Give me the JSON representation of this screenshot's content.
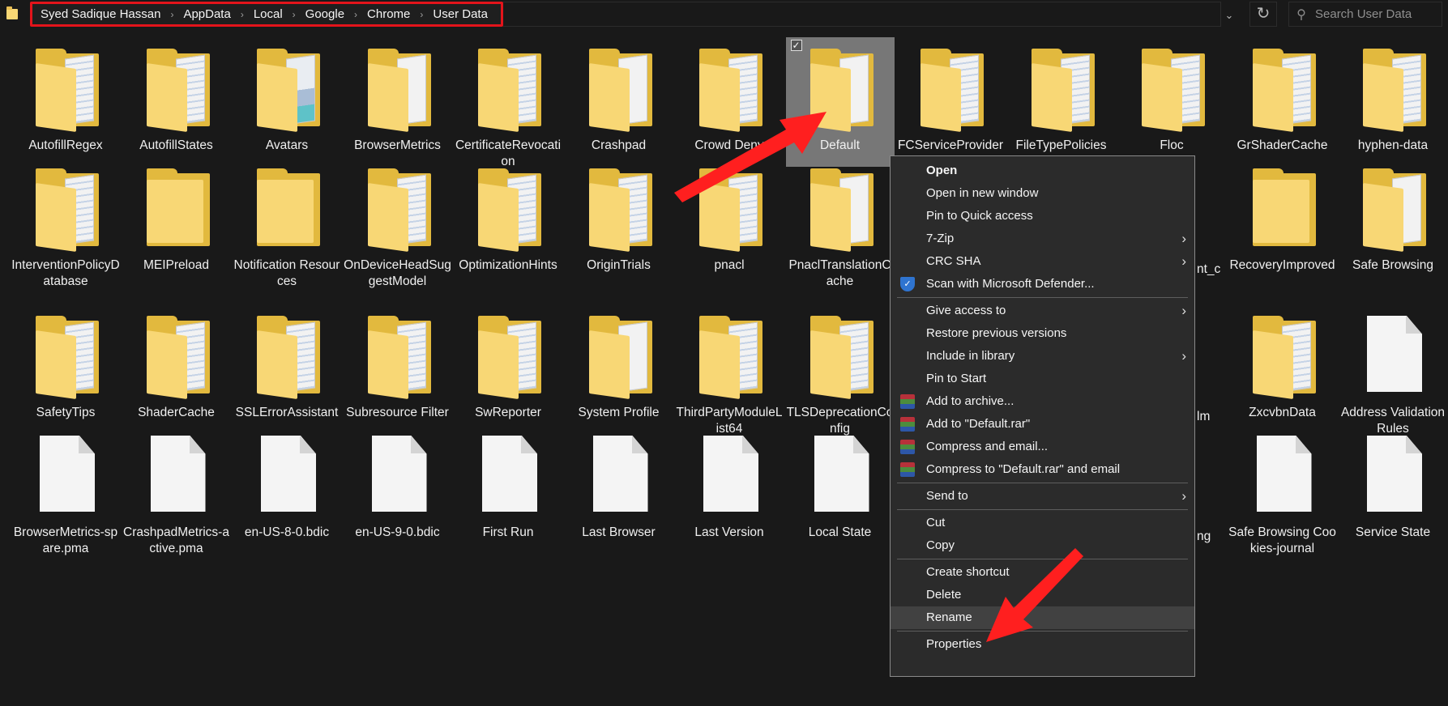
{
  "breadcrumb": [
    "Syed Sadique Hassan",
    "AppData",
    "Local",
    "Google",
    "Chrome",
    "User Data"
  ],
  "search": {
    "placeholder": "Search User Data"
  },
  "icons": {
    "dropdown": "chevron-down-icon",
    "refresh": "refresh-icon",
    "search": "search-icon"
  },
  "rows": [
    [
      {
        "label": "AutofillRegex",
        "kind": "folder",
        "style": "stripe"
      },
      {
        "label": "AutofillStates",
        "kind": "folder",
        "style": "stripe"
      },
      {
        "label": "Avatars",
        "kind": "folder",
        "style": "pic"
      },
      {
        "label": "BrowserMetrics",
        "kind": "folder",
        "style": "plain-paper"
      },
      {
        "label": "CertificateRevocation",
        "kind": "folder",
        "style": "stripe"
      },
      {
        "label": "Crashpad",
        "kind": "folder",
        "style": "plain-paper"
      },
      {
        "label": "Crowd Deny",
        "kind": "folder",
        "style": "stripe"
      },
      {
        "label": "Default",
        "kind": "folder",
        "style": "plain-paper",
        "selected": true
      },
      {
        "label": "FCServiceProvider",
        "kind": "folder",
        "style": "stripe"
      },
      {
        "label": "FileTypePolicies",
        "kind": "folder",
        "style": "stripe"
      },
      {
        "label": "Floc",
        "kind": "folder",
        "style": "stripe"
      },
      {
        "label": "GrShaderCache",
        "kind": "folder",
        "style": "stripe"
      },
      {
        "label": "hyphen-data",
        "kind": "folder",
        "style": "stripe"
      }
    ],
    [
      {
        "label": "InterventionPolicyDatabase",
        "kind": "folder",
        "style": "stripe"
      },
      {
        "label": "MEIPreload",
        "kind": "folder",
        "style": "plain"
      },
      {
        "label": "Notification Resources",
        "kind": "folder",
        "style": "plain"
      },
      {
        "label": "OnDeviceHeadSuggestModel",
        "kind": "folder",
        "style": "stripe"
      },
      {
        "label": "OptimizationHints",
        "kind": "folder",
        "style": "stripe"
      },
      {
        "label": "OriginTrials",
        "kind": "folder",
        "style": "stripe"
      },
      {
        "label": "pnacl",
        "kind": "folder",
        "style": "stripe"
      },
      {
        "label": "PnaclTranslationCache",
        "kind": "folder",
        "style": "plain-paper"
      },
      null,
      null,
      {
        "label": "nt_c",
        "kind": "folder",
        "style": "partial"
      },
      {
        "label": "RecoveryImproved",
        "kind": "folder",
        "style": "plain"
      },
      {
        "label": "Safe Browsing",
        "kind": "folder",
        "style": "plain-paper"
      }
    ],
    [
      {
        "label": "SafetyTips",
        "kind": "folder",
        "style": "stripe"
      },
      {
        "label": "ShaderCache",
        "kind": "folder",
        "style": "stripe"
      },
      {
        "label": "SSLErrorAssistant",
        "kind": "folder",
        "style": "stripe"
      },
      {
        "label": "Subresource Filter",
        "kind": "folder",
        "style": "stripe"
      },
      {
        "label": "SwReporter",
        "kind": "folder",
        "style": "stripe"
      },
      {
        "label": "System Profile",
        "kind": "folder",
        "style": "plain-paper"
      },
      {
        "label": "ThirdPartyModuleList64",
        "kind": "folder",
        "style": "stripe"
      },
      {
        "label": "TLSDeprecationConfig",
        "kind": "folder",
        "style": "stripe"
      },
      null,
      null,
      {
        "label": "lm",
        "kind": "folder",
        "style": "partial"
      },
      {
        "label": "ZxcvbnData",
        "kind": "folder",
        "style": "stripe"
      },
      {
        "label": "Address Validation Rules",
        "kind": "file"
      }
    ],
    [
      {
        "label": "BrowserMetrics-spare.pma",
        "kind": "file"
      },
      {
        "label": "CrashpadMetrics-active.pma",
        "kind": "file"
      },
      {
        "label": "en-US-8-0.bdic",
        "kind": "file"
      },
      {
        "label": "en-US-9-0.bdic",
        "kind": "file"
      },
      {
        "label": "First Run",
        "kind": "file"
      },
      {
        "label": "Last Browser",
        "kind": "file"
      },
      {
        "label": "Last Version",
        "kind": "file"
      },
      {
        "label": "Local State",
        "kind": "file"
      },
      null,
      null,
      {
        "label": "ng",
        "kind": "file",
        "style": "partial"
      },
      {
        "label": "Safe Browsing Cookies-journal",
        "kind": "file"
      },
      {
        "label": "Service State",
        "kind": "file"
      }
    ]
  ],
  "context_menu": {
    "items": [
      {
        "label": "Open",
        "bold": true
      },
      {
        "label": "Open in new window"
      },
      {
        "label": "Pin to Quick access"
      },
      {
        "label": "7-Zip",
        "submenu": true
      },
      {
        "label": "CRC SHA",
        "submenu": true
      },
      {
        "label": "Scan with Microsoft Defender...",
        "icon": "defender-shield-icon"
      },
      {
        "separator": true
      },
      {
        "label": "Give access to",
        "submenu": true
      },
      {
        "label": "Restore previous versions"
      },
      {
        "label": "Include in library",
        "submenu": true
      },
      {
        "label": "Pin to Start"
      },
      {
        "label": "Add to archive...",
        "icon": "winrar-icon"
      },
      {
        "label": "Add to \"Default.rar\"",
        "icon": "winrar-icon"
      },
      {
        "label": "Compress and email...",
        "icon": "winrar-icon"
      },
      {
        "label": "Compress to \"Default.rar\" and email",
        "icon": "winrar-icon"
      },
      {
        "separator": true
      },
      {
        "label": "Send to",
        "submenu": true
      },
      {
        "separator": true
      },
      {
        "label": "Cut"
      },
      {
        "label": "Copy"
      },
      {
        "separator": true
      },
      {
        "label": "Create shortcut"
      },
      {
        "label": "Delete"
      },
      {
        "label": "Rename",
        "hover": true
      },
      {
        "separator": true
      },
      {
        "label": "Properties"
      }
    ]
  },
  "colors": {
    "background": "#191919",
    "highlight_border": "#e3141b",
    "selection": "#777777",
    "arrow": "#ff1f1f",
    "folder": "#f8d775"
  }
}
